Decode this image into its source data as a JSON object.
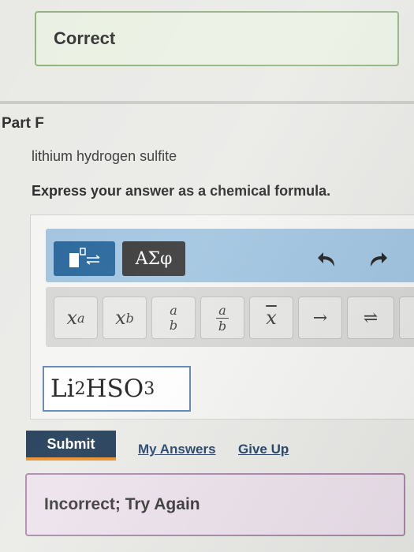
{
  "feedback_top": {
    "text": "Correct"
  },
  "part": {
    "title": "Part F"
  },
  "question": {
    "compound": "lithium hydrogen sulfite",
    "instruction": "Express your answer as a chemical formula."
  },
  "toolbar": {
    "greek_label": "ΑΣφ",
    "undo_icon": "undo-icon",
    "redo_icon": "redo-icon"
  },
  "keys": {
    "superscript": "x",
    "superscript_sup": "a",
    "subscript": "x",
    "subscript_sub": "b",
    "frac_num": "a",
    "frac_den": "b",
    "bar": "x",
    "arrow": "→",
    "equilibrium": "⇌"
  },
  "answer": {
    "part1": "Li",
    "sub1": "2",
    "part2": " HSO",
    "sub2": "3"
  },
  "actions": {
    "submit": "Submit",
    "my_answers": "My Answers",
    "give_up": "Give Up"
  },
  "feedback_bottom": {
    "text": "Incorrect; Try Again"
  }
}
